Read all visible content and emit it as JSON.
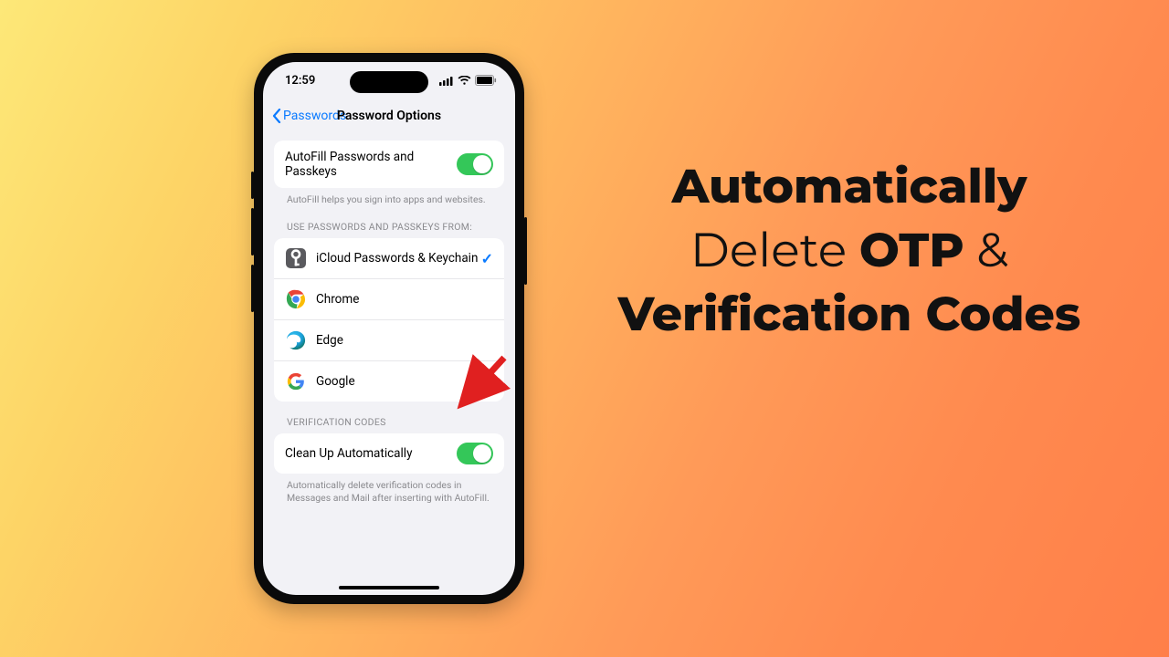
{
  "headline": {
    "w1": "Automatically",
    "w2": "Delete",
    "w3": "OTP",
    "w4": "&",
    "w5": "Verification Codes"
  },
  "status": {
    "time": "12:59"
  },
  "nav": {
    "back_label": "Passwords",
    "title": "Password Options"
  },
  "section_autofill": {
    "label": "AutoFill Passwords and Passkeys",
    "footer": "AutoFill helps you sign into apps and websites.",
    "toggle_on": true
  },
  "section_providers": {
    "header": "USE PASSWORDS AND PASSKEYS FROM:",
    "items": [
      {
        "label": "iCloud Passwords & Keychain",
        "checked": true,
        "icon": "keychain"
      },
      {
        "label": "Chrome",
        "checked": false,
        "icon": "chrome"
      },
      {
        "label": "Edge",
        "checked": false,
        "icon": "edge"
      },
      {
        "label": "Google",
        "checked": false,
        "icon": "google"
      }
    ]
  },
  "section_verification": {
    "header": "VERIFICATION CODES",
    "label": "Clean Up Automatically",
    "toggle_on": true,
    "footer": "Automatically delete verification codes in Messages and Mail after inserting with AutoFill."
  }
}
